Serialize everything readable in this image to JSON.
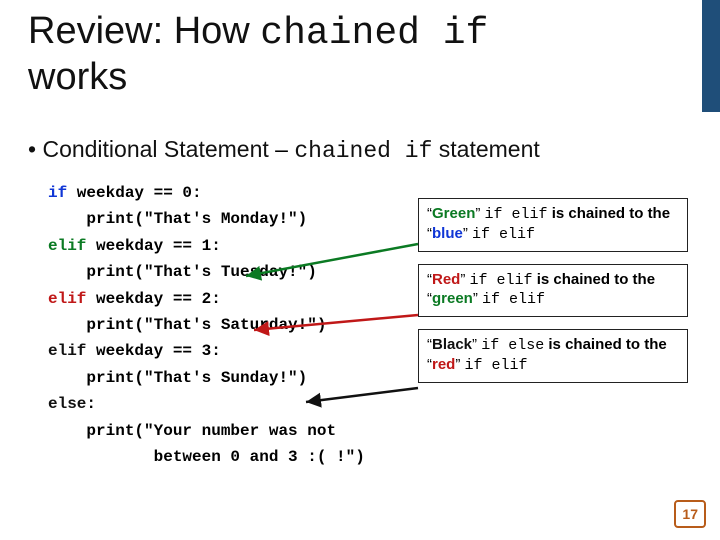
{
  "title": {
    "pre": "Review: How ",
    "mono": "chained if",
    "post": " works"
  },
  "bullet": {
    "marker": "•",
    "pre": " Conditional Statement ",
    "dash": "– ",
    "mono": "chained if",
    "post": "  statement"
  },
  "code": {
    "l1_kw": "if",
    "l1_rest": " weekday == 0:",
    "l2": "    print(\"That's Monday!\")",
    "l3_kw": "elif",
    "l3_rest": " weekday == 1:",
    "l4": "    print(\"That's Tuesday!\")",
    "l5_kw": "elif",
    "l5_rest": " weekday == 2:",
    "l6": "    print(\"That's Saturday!\")",
    "l7_kw": "elif",
    "l7_rest": " weekday == 3:",
    "l8": "    print(\"That's Sunday!\")",
    "l9_kw": "else",
    "l9_rest": ":",
    "l10a": "    print(\"Your number was not",
    "l10b": "           between 0 and 3 :( !\")"
  },
  "callouts": {
    "c1": {
      "q1": "“",
      "color1": "Green",
      "q2": "” ",
      "mono1": "if elif",
      "mid": " is chained to the ",
      "q3": "“",
      "color2": "blue",
      "q4": "” ",
      "mono2": "if elif"
    },
    "c2": {
      "q1": "“",
      "color1": "Red",
      "q2": "” ",
      "mono1": "if elif",
      "mid": " is chained to the ",
      "q3": "“",
      "color2": "green",
      "q4": "” ",
      "mono2": "if elif"
    },
    "c3": {
      "q1": "“",
      "color1": "Black",
      "q2": "” ",
      "mono1": "if else",
      "mid": " is chained to the ",
      "q3": "“",
      "color2": "red",
      "q4": "” ",
      "mono2": "if elif"
    }
  },
  "pagenum": "17",
  "colors": {
    "accent": "#1f4e79",
    "green": "#0b7a23",
    "blue": "#1036d6",
    "red": "#c01818",
    "page_border": "#b85c1a"
  }
}
